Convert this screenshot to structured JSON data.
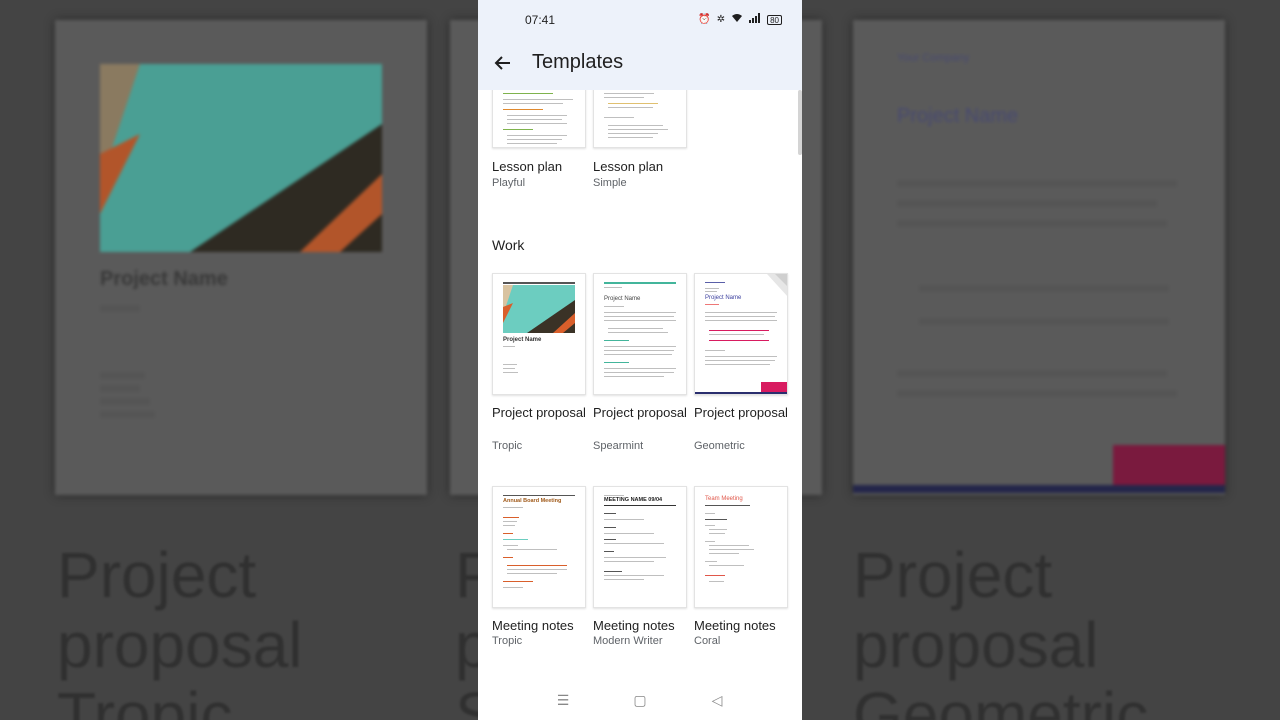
{
  "status": {
    "time": "07:41",
    "battery": "80"
  },
  "appbar": {
    "title": "Templates"
  },
  "sections": [
    {
      "name": "Work"
    }
  ],
  "top_templates": [
    {
      "label": "Lesson plan",
      "sub": "Playful"
    },
    {
      "label": "Lesson plan",
      "sub": "Simple"
    }
  ],
  "work_templates": [
    {
      "label": "Project proposal",
      "sub": "Tropic",
      "thumb_title": "Project Name"
    },
    {
      "label": "Project proposal",
      "sub": "Spearmint",
      "thumb_title": "Project Name"
    },
    {
      "label": "Project proposal",
      "sub": "Geometric",
      "thumb_title": "Project Name"
    }
  ],
  "meeting_templates": [
    {
      "label": "Meeting notes",
      "sub": "Tropic",
      "thumb_title": "Annual Board Meeting"
    },
    {
      "label": "Meeting notes",
      "sub": "Modern Writer",
      "thumb_title": "MEETING NAME 09/04"
    },
    {
      "label": "Meeting notes",
      "sub": "Coral",
      "thumb_title": "Team Meeting"
    }
  ],
  "background": {
    "left_title": "Project Name",
    "left_big": [
      "Project",
      "proposal",
      "Tropic"
    ],
    "right_big": [
      "Project",
      "proposal",
      "Geometric"
    ],
    "right_title": "Project Name",
    "right_company": "Your Company",
    "mid_big": [
      "P",
      "p",
      "S"
    ]
  },
  "colors": {
    "appbar_bg": "#edf2fa",
    "tropic_teal": "#5bbfb0",
    "tropic_orange": "#d95f2b",
    "spearmint": "#43b59b",
    "geometric_pink": "#d81b60",
    "geometric_navy": "#2a2e6e",
    "coral": "#e0574a"
  }
}
